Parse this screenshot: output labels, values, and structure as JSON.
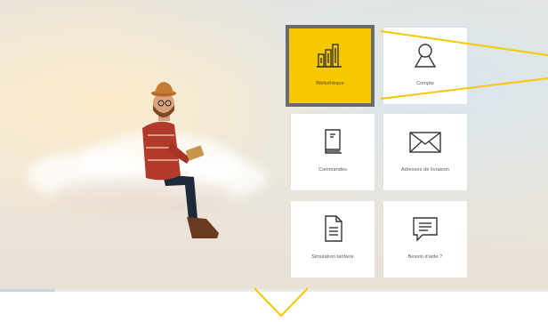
{
  "colors": {
    "accent": "#f7c800",
    "selected_border": "#6b6b6b",
    "icon_stroke": "#333333",
    "callout": "#f7c800"
  },
  "scroll_progress": 0.1,
  "menu": {
    "tiles": [
      {
        "label": "Bibliothèque",
        "icon": "library-books-icon",
        "selected": true
      },
      {
        "label": "Compte",
        "icon": "user-icon",
        "selected": false
      },
      {
        "label": "Commandes",
        "icon": "orders-book-icon",
        "selected": false
      },
      {
        "label": "Adresses de livraison",
        "icon": "envelope-icon",
        "selected": false
      },
      {
        "label": "Simulation tarifaire",
        "icon": "document-icon",
        "selected": false
      },
      {
        "label": "Besoin d'aide ?",
        "icon": "chat-bubble-icon",
        "selected": false
      }
    ]
  },
  "scroll_indicator": {
    "icon": "chevron-down-icon"
  }
}
